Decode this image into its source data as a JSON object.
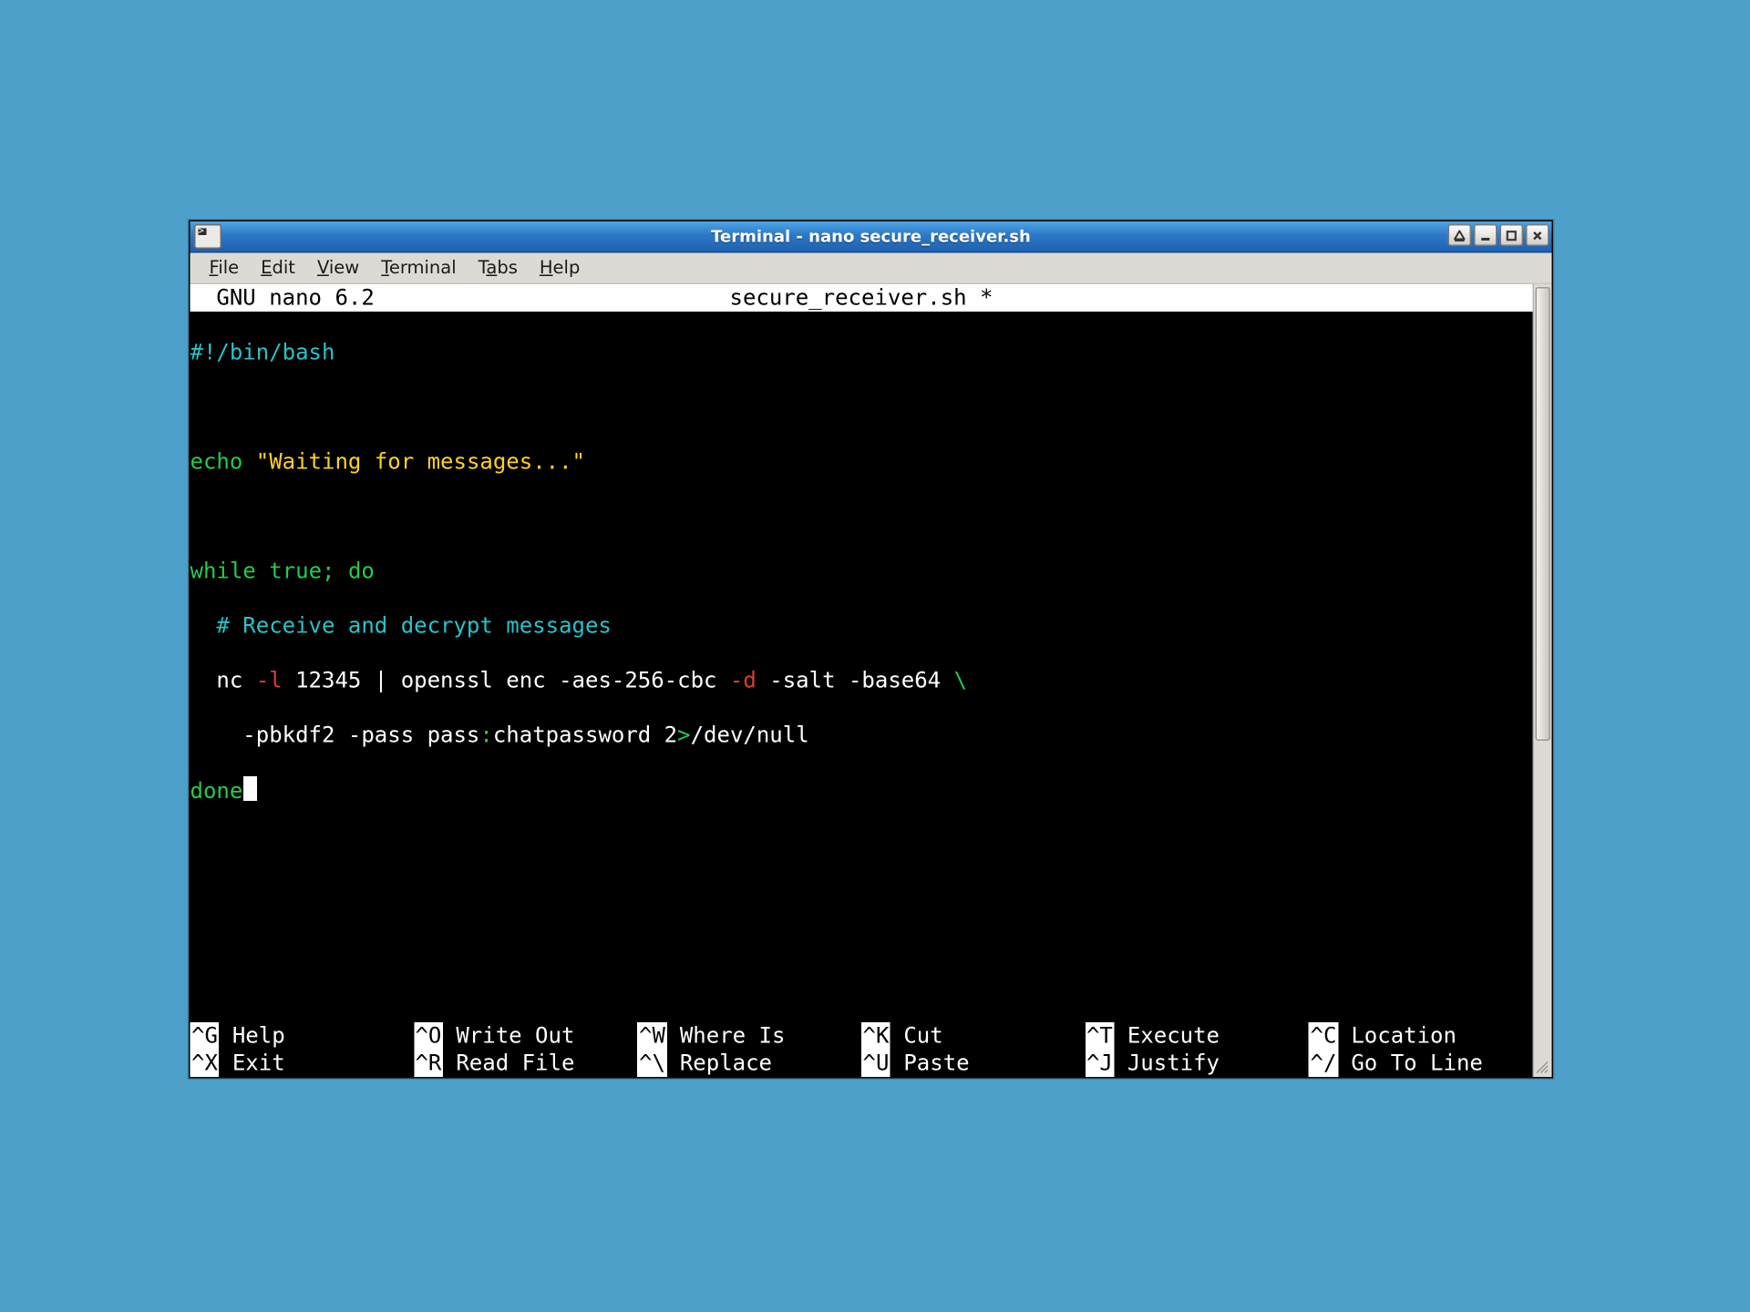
{
  "window": {
    "title": "Terminal - nano secure_receiver.sh"
  },
  "menubar": {
    "file": "File",
    "edit": "Edit",
    "view": "View",
    "terminal": "Terminal",
    "tabs": "Tabs",
    "help": "Help"
  },
  "nano": {
    "version_label": "GNU nano 6.2",
    "filename_label": "secure_receiver.sh *"
  },
  "code": {
    "l1_shebang": "#!/bin/bash",
    "l3_echo": "echo",
    "l3_sp": " ",
    "l3_str": "\"Waiting for messages...\"",
    "l5_while": "while",
    "l5_sp1": " ",
    "l5_true": "true",
    "l5_semi": ";",
    "l5_sp2": " ",
    "l5_do": "do",
    "l6_indent": "  ",
    "l6_comment": "# Receive and decrypt messages",
    "l7_indent": "  ",
    "l7_p1": "nc ",
    "l7_flag": "-l",
    "l7_p2": " 12345 | openssl enc -aes-256-cbc ",
    "l7_flag2": "-d",
    "l7_p3": " -salt -base64 ",
    "l7_bs": "\\",
    "l8_indent": "    ",
    "l8_p1": "-pbkdf2 -pass pass",
    "l8_colon": ":",
    "l8_p2": "chatpassword 2",
    "l8_gt": ">",
    "l8_p3": "/dev/null",
    "l9_done": "done"
  },
  "shortcuts": {
    "row1": [
      {
        "key": "^G",
        "label": "Help"
      },
      {
        "key": "^O",
        "label": "Write Out"
      },
      {
        "key": "^W",
        "label": "Where Is"
      },
      {
        "key": "^K",
        "label": "Cut"
      },
      {
        "key": "^T",
        "label": "Execute"
      },
      {
        "key": "^C",
        "label": "Location"
      }
    ],
    "row2": [
      {
        "key": "^X",
        "label": "Exit"
      },
      {
        "key": "^R",
        "label": "Read File"
      },
      {
        "key": "^\\",
        "label": "Replace"
      },
      {
        "key": "^U",
        "label": "Paste"
      },
      {
        "key": "^J",
        "label": "Justify"
      },
      {
        "key": "^/",
        "label": "Go To Line"
      }
    ]
  }
}
